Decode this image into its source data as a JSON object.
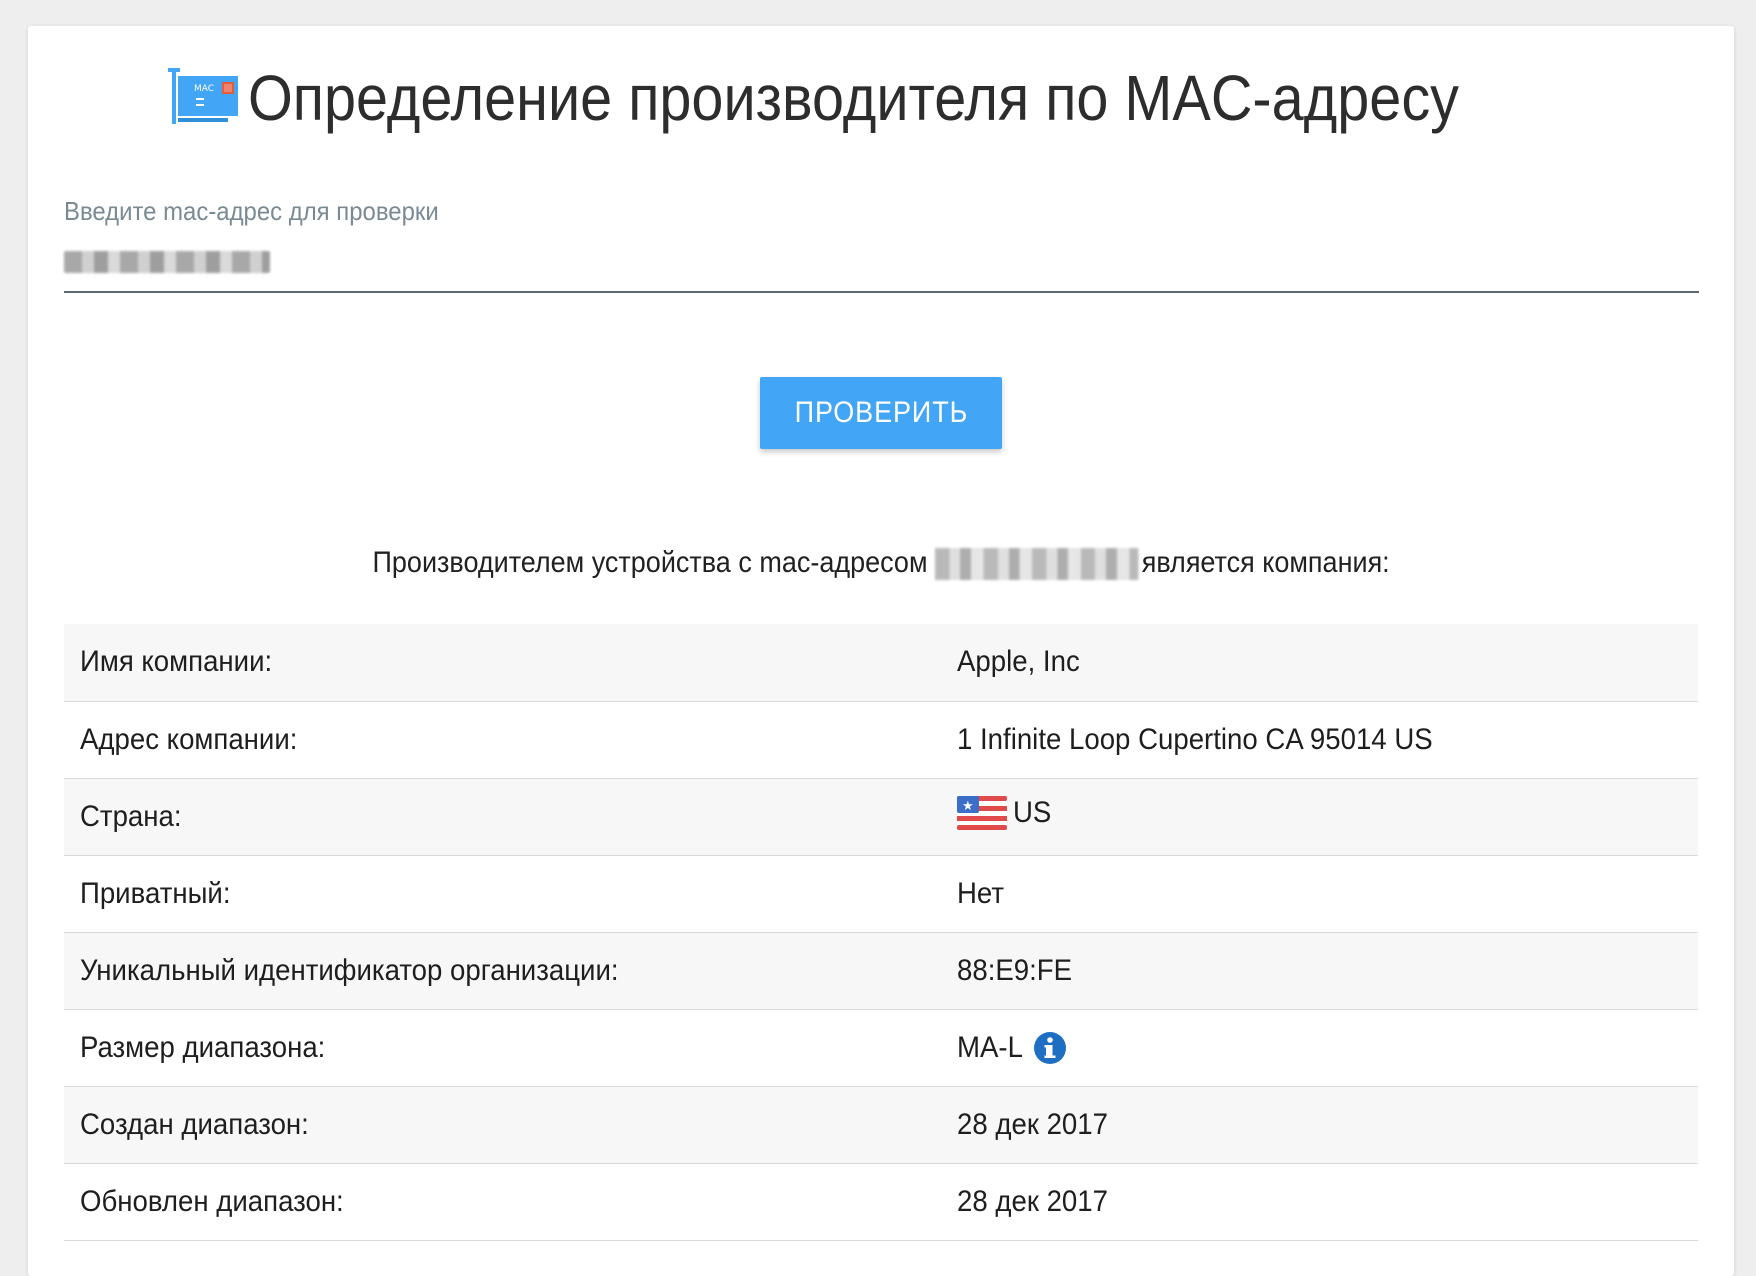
{
  "header": {
    "title": "Определение производителя по MAC-адресу",
    "logo_text": "MAC"
  },
  "form": {
    "label": "Введите mac-адрес для проверки",
    "input_value_redacted": true,
    "button_label": "ПРОВЕРИТЬ"
  },
  "result": {
    "prefix": "Производителем устройства с mac-адресом",
    "suffix": "является компания:"
  },
  "table": {
    "rows": [
      {
        "label": "Имя компании:",
        "value": "Apple, Inc"
      },
      {
        "label": "Адрес компании:",
        "value": "1 Infinite Loop Cupertino CA 95014 US"
      },
      {
        "label": "Страна:",
        "value": "US",
        "icon": "us-flag-icon"
      },
      {
        "label": "Приватный:",
        "value": "Нет"
      },
      {
        "label": "Уникальный идентификатор организации:",
        "value": "88:E9:FE"
      },
      {
        "label": "Размер диапазона:",
        "value": "MA-L",
        "icon": "info-icon"
      },
      {
        "label": "Создан диапазон:",
        "value": "28 дек 2017"
      },
      {
        "label": "Обновлен диапазон:",
        "value": "28 дек 2017"
      }
    ]
  },
  "colors": {
    "accent": "#42a5f5",
    "info_icon": "#1e6fc4",
    "label_gray": "#7a8a94"
  }
}
